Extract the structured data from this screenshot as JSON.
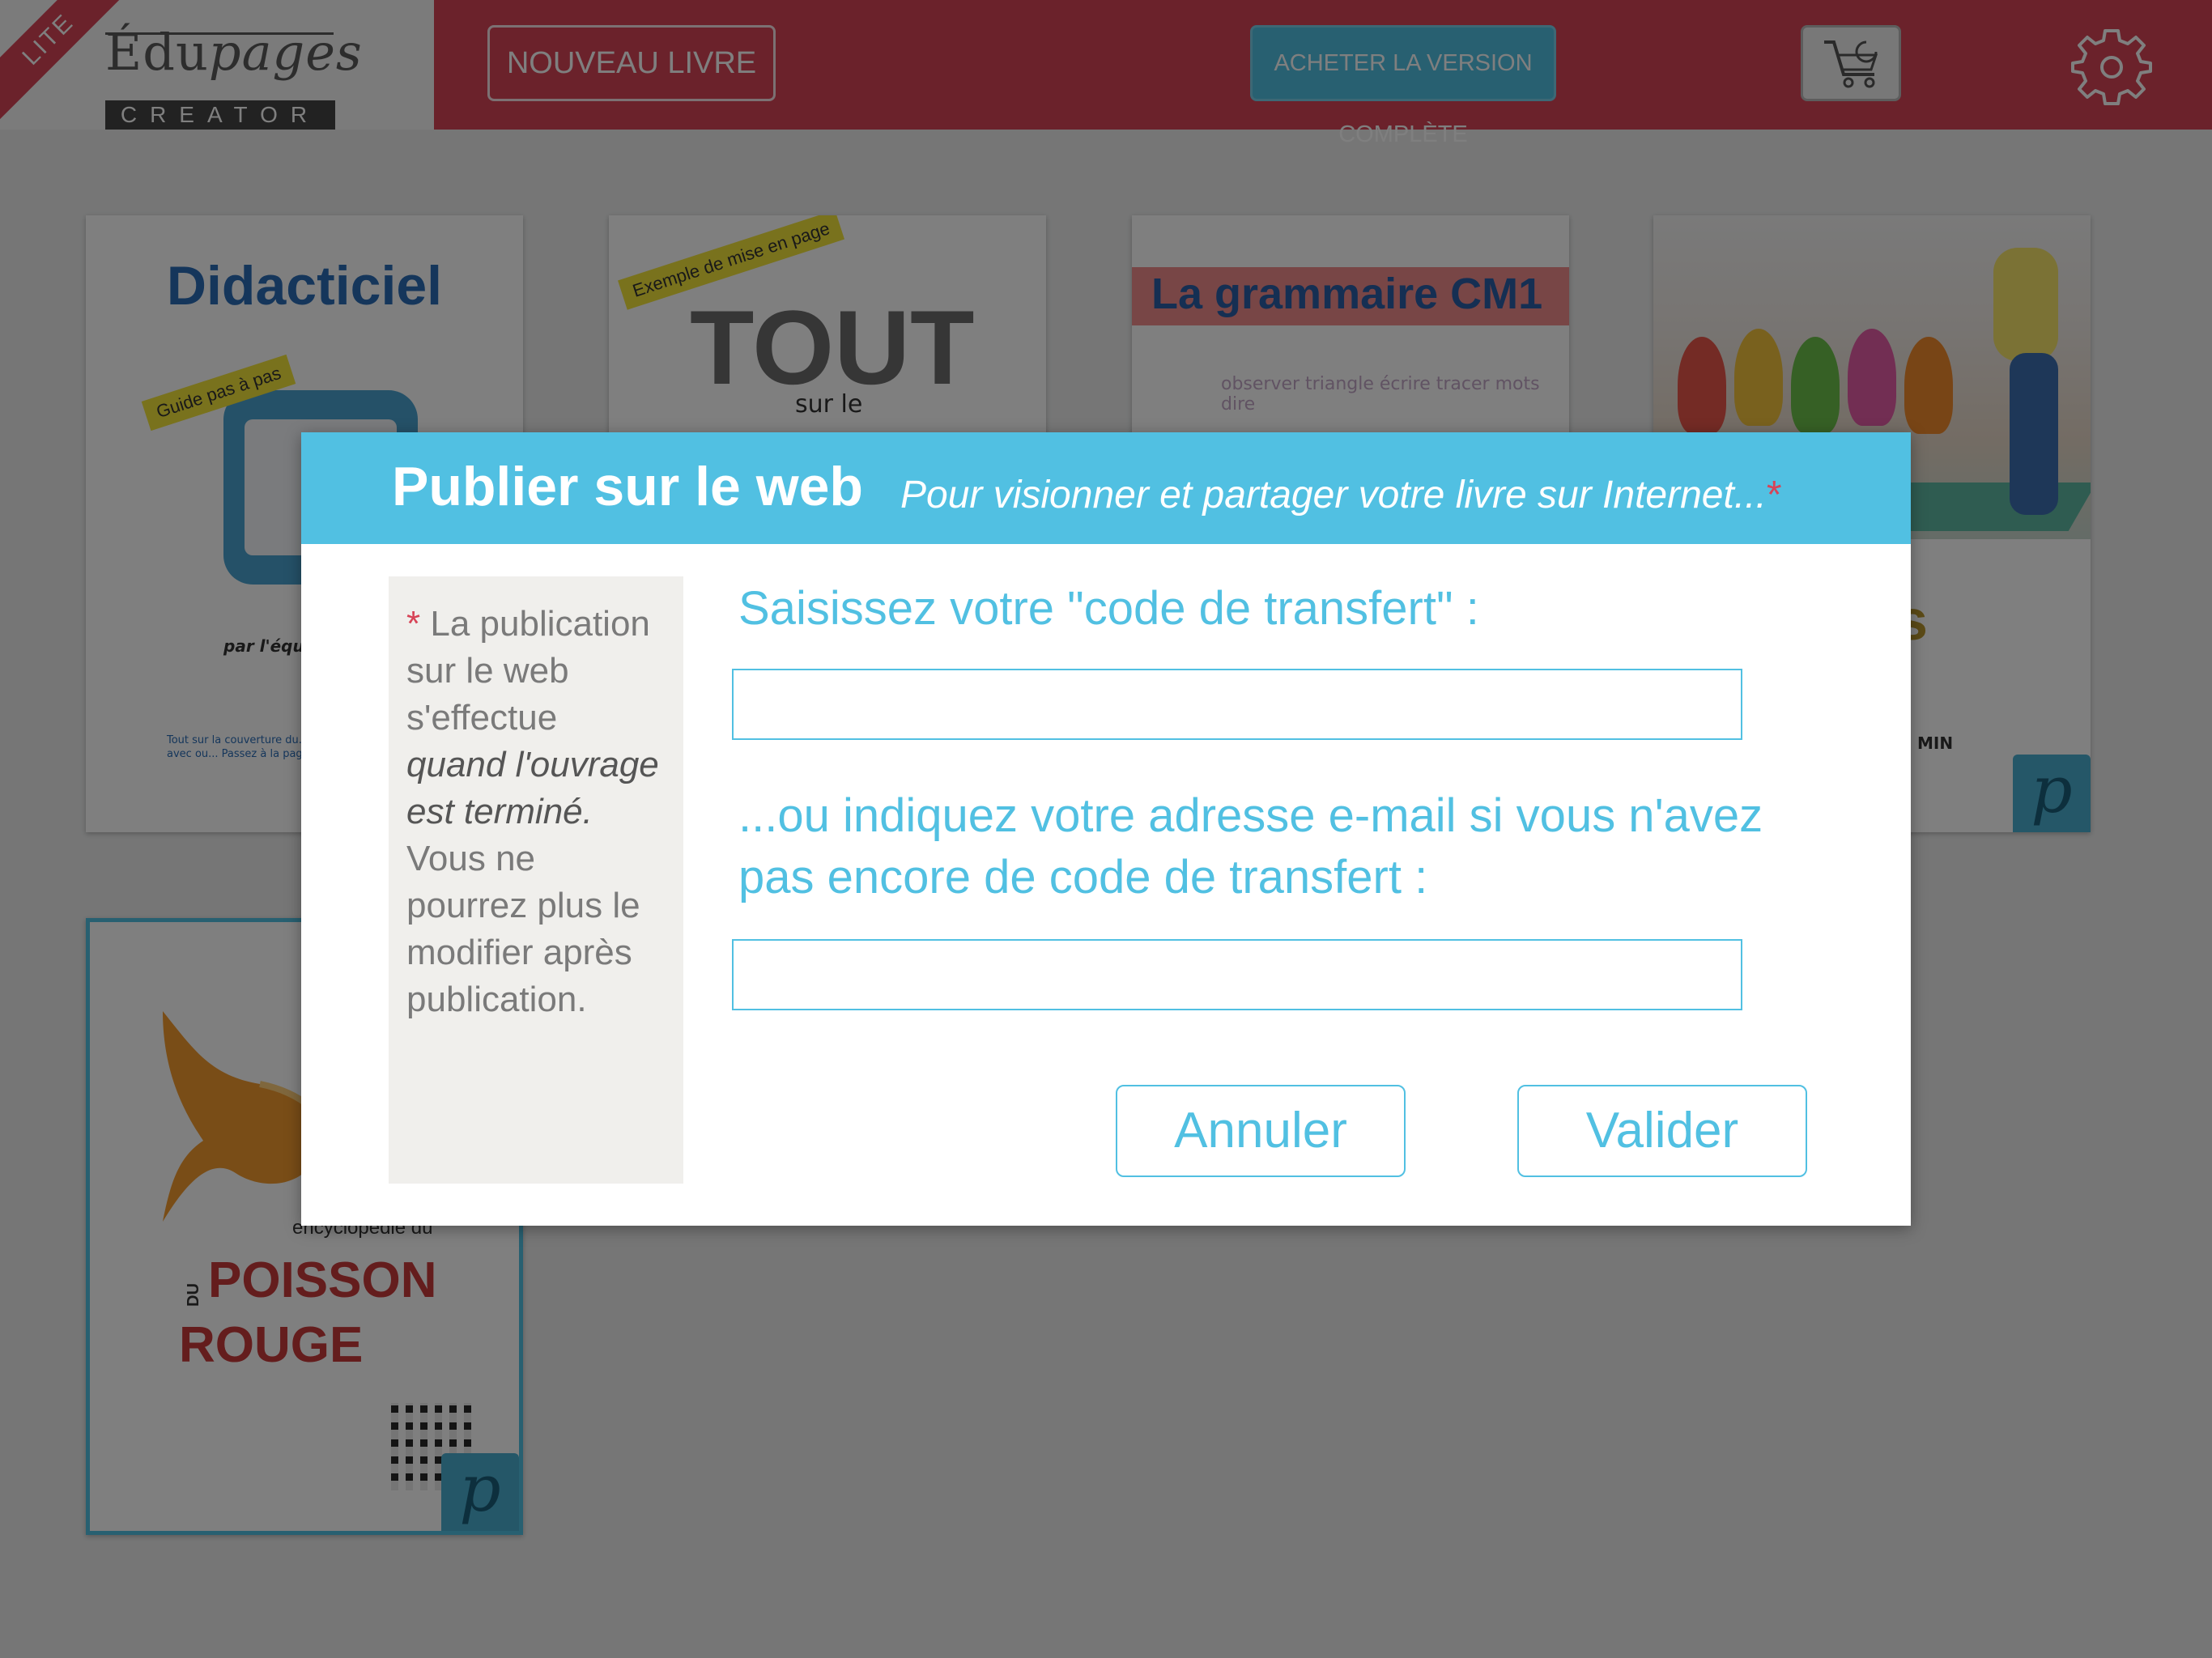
{
  "app": {
    "lite_ribbon": "LITE",
    "logo_title_main": "Édu",
    "logo_title_italic": "pages",
    "logo_subtitle": "CREATOR"
  },
  "toolbar": {
    "new_book": "NOUVEAU LIVRE",
    "buy_full": "ACHETER LA VERSION COMPLÈTE",
    "cart_icon": "cart-icon",
    "settings_icon": "gear-icon"
  },
  "books": [
    {
      "title": "Didacticiel",
      "tag": "Guide pas à pas",
      "author": "par l'équip",
      "small": "Tout sur la couverture du... nom de l'auteur, avec ou... Passez à la page suivante"
    },
    {
      "tag": "Exemple de mise en page",
      "big": "TOUT",
      "small": "sur le"
    },
    {
      "title": "La grammaire CM1",
      "words": "observer  triangle  écrire  tracer  mots  dire"
    },
    {
      "letter": "s",
      "small": "MIN",
      "badge": "p"
    },
    {
      "encyclo": "encyclopédie du",
      "du_vertical": "DU",
      "title_line1": "POISSON",
      "title_line2": "ROUGE",
      "badge": "p"
    }
  ],
  "dialog": {
    "title": "Publier sur le web",
    "subtitle": "Pour visionner et partager votre livre sur Internet...",
    "subtitle_star": "*",
    "note_star": "*",
    "note_part1": "La publication sur le web s'effectue",
    "note_italic": "quand l'ouvrage est terminé.",
    "note_part2": "Vous ne pourrez plus le modifier après publication.",
    "label_code": "Saisissez votre \"code de transfert\" :",
    "code_value": "",
    "label_email": "...ou indiquez votre adresse e-mail si vous n'avez pas encore de code de transfert :",
    "email_value": "",
    "cancel": "Annuler",
    "validate": "Valider"
  },
  "colors": {
    "brand_red": "#d74457",
    "accent_blue": "#51c0e2",
    "overlay": "rgba(0,0,0,0.5)"
  }
}
